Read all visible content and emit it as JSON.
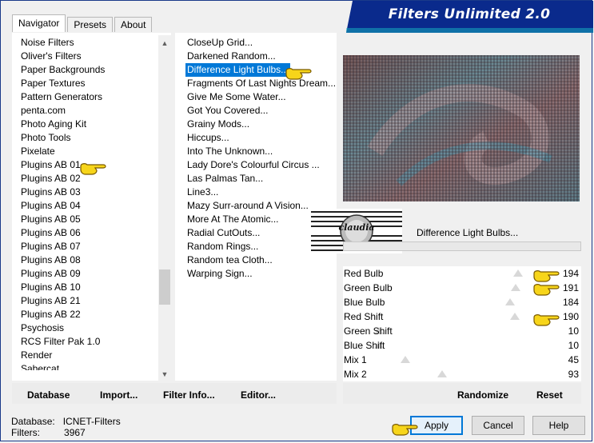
{
  "window": {
    "title": "Filters Unlimited 2.0"
  },
  "tabs": [
    {
      "label": "Navigator",
      "active": true
    },
    {
      "label": "Presets",
      "active": false
    },
    {
      "label": "About",
      "active": false
    }
  ],
  "categories": [
    "Noise Filters",
    "Oliver's Filters",
    "Paper Backgrounds",
    "Paper Textures",
    "Pattern Generators",
    "penta.com",
    "Photo Aging Kit",
    "Photo Tools",
    "Pixelate",
    "Plugins AB 01",
    "Plugins AB 02",
    "Plugins AB 03",
    "Plugins AB 04",
    "Plugins AB 05",
    "Plugins AB 06",
    "Plugins AB 07",
    "Plugins AB 08",
    "Plugins AB 09",
    "Plugins AB 10",
    "Plugins AB 21",
    "Plugins AB 22",
    "Psychosis",
    "RCS Filter Pak 1.0",
    "Render",
    "Sabercat"
  ],
  "filters": [
    "CloseUp Grid...",
    "Darkened Random...",
    "Difference Light Bulbs...",
    "Fragments Of Last Nights Dream...",
    "Give Me Some Water...",
    "Got You Covered...",
    "Grainy Mods...",
    "Hiccups...",
    "Into The Unknown...",
    "Lady Dore's Colourful Circus ...",
    "Las Palmas Tan...",
    "Line3...",
    "Mazy Surr-around A Vision...",
    "More At The Atomic...",
    "Radial CutOuts...",
    "Random Rings...",
    "Random tea Cloth...",
    "Warping Sign..."
  ],
  "selected_filter": "Difference Light Bulbs...",
  "filter_name_display": "Difference Light Bulbs...",
  "watermark": "claudia",
  "params": [
    {
      "label": "Red Bulb",
      "value": "194",
      "fraction": 0.761
    },
    {
      "label": "Green Bulb",
      "value": "191",
      "fraction": 0.749
    },
    {
      "label": "Blue Bulb",
      "value": "184",
      "fraction": 0.722
    },
    {
      "label": "Red Shift",
      "value": "190",
      "fraction": 0.745
    },
    {
      "label": "Green Shift",
      "value": "10",
      "fraction": 0.039
    },
    {
      "label": "Blue Shift",
      "value": "10",
      "fraction": 0.039
    },
    {
      "label": "Mix 1",
      "value": "45",
      "fraction": 0.176
    },
    {
      "label": "Mix 2",
      "value": "93",
      "fraction": 0.365
    }
  ],
  "bottom_left": {
    "database": "Database",
    "import": "Import...",
    "filter_info": "Filter Info...",
    "editor": "Editor..."
  },
  "bottom_right": {
    "randomize": "Randomize",
    "reset": "Reset"
  },
  "status": {
    "database_label": "Database:",
    "database_value": "ICNET-Filters",
    "filters_label": "Filters:",
    "filters_value": "3967"
  },
  "buttons": {
    "apply": "Apply",
    "cancel": "Cancel",
    "help": "Help"
  },
  "colors": {
    "accent": "#0078d7",
    "banner": "#0a2a8c",
    "hand": "#f7d51a"
  }
}
